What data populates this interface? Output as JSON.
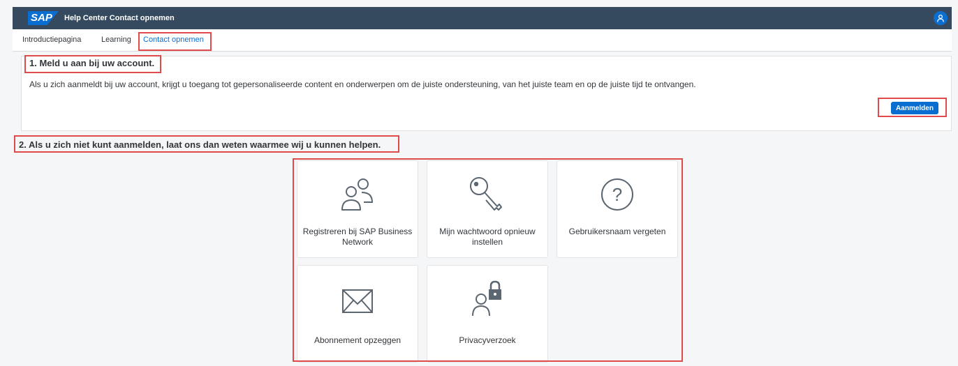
{
  "header": {
    "logo_text": "SAP",
    "title": "Help Center Contact opnemen",
    "avatar_icon": "user-icon"
  },
  "tabs": [
    {
      "label": "Introductiepagina",
      "active": false
    },
    {
      "label": "Learning",
      "active": false
    },
    {
      "label": "Contact opnemen",
      "active": true
    }
  ],
  "section1": {
    "heading": "1. Meld u aan bij uw account.",
    "description": "Als u zich aanmeldt bij uw account, krijgt u toegang tot gepersonaliseerde content en onderwerpen om de juiste ondersteuning, van het juiste team en op de juiste tijd te ontvangen.",
    "button_label": "Aanmelden"
  },
  "section2": {
    "heading": "2. Als u zich niet kunt aanmelden, laat ons dan weten waarmee wij u kunnen helpen.",
    "tiles": [
      {
        "icon": "add-contact-icon",
        "label": "Registreren bij SAP Business Network"
      },
      {
        "icon": "key-icon",
        "label": "Mijn wachtwoord opnieuw instellen"
      },
      {
        "icon": "question-icon",
        "label": "Gebruikersnaam vergeten"
      },
      {
        "icon": "envelope-icon",
        "label": "Abonnement opzeggen"
      },
      {
        "icon": "user-lock-icon",
        "label": "Privacyverzoek"
      }
    ]
  },
  "colors": {
    "shell": "#354a5f",
    "accent": "#0a6ed1",
    "highlight": "#e04a4a"
  }
}
